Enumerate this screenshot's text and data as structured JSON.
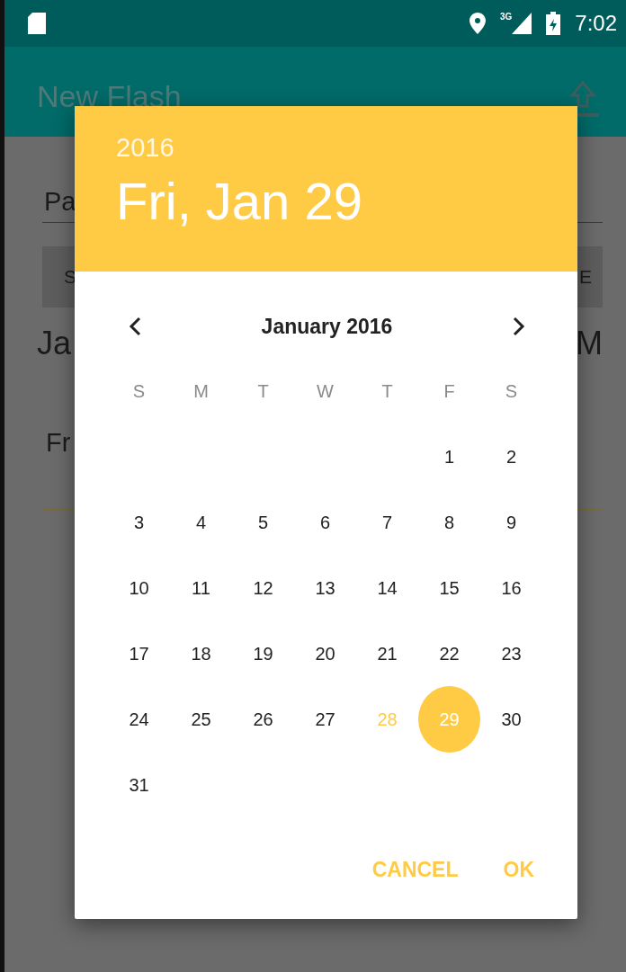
{
  "status_bar": {
    "network": "3G",
    "time": "7:02"
  },
  "app_bar": {
    "title": "New Flash"
  },
  "backdrop": {
    "field_text": "Pa",
    "button_left": "S",
    "button_right": "E",
    "line_left": "Ja",
    "line_right": "M",
    "label": "Fr"
  },
  "dialog": {
    "year": "2016",
    "date": "Fri, Jan 29",
    "month": "January 2016",
    "weekdays": [
      "S",
      "M",
      "T",
      "W",
      "T",
      "F",
      "S"
    ],
    "weeks": [
      [
        {
          "label": "1",
          "selected": false,
          "today": false
        },
        {
          "label": "2",
          "selected": false,
          "today": false
        }
      ],
      [
        {
          "label": "3",
          "selected": false,
          "today": false
        },
        {
          "label": "4",
          "selected": false,
          "today": false
        },
        {
          "label": "5",
          "selected": false,
          "today": false
        },
        {
          "label": "6",
          "selected": false,
          "today": false
        },
        {
          "label": "7",
          "selected": false,
          "today": false
        },
        {
          "label": "8",
          "selected": false,
          "today": false
        },
        {
          "label": "9",
          "selected": false,
          "today": false
        }
      ],
      [
        {
          "label": "10",
          "selected": false,
          "today": false
        },
        {
          "label": "11",
          "selected": false,
          "today": false
        },
        {
          "label": "12",
          "selected": false,
          "today": false
        },
        {
          "label": "13",
          "selected": false,
          "today": false
        },
        {
          "label": "14",
          "selected": false,
          "today": false
        },
        {
          "label": "15",
          "selected": false,
          "today": false
        },
        {
          "label": "16",
          "selected": false,
          "today": false
        }
      ],
      [
        {
          "label": "17",
          "selected": false,
          "today": false
        },
        {
          "label": "18",
          "selected": false,
          "today": false
        },
        {
          "label": "19",
          "selected": false,
          "today": false
        },
        {
          "label": "20",
          "selected": false,
          "today": false
        },
        {
          "label": "21",
          "selected": false,
          "today": false
        },
        {
          "label": "22",
          "selected": false,
          "today": false
        },
        {
          "label": "23",
          "selected": false,
          "today": false
        }
      ],
      [
        {
          "label": "24",
          "selected": false,
          "today": false
        },
        {
          "label": "25",
          "selected": false,
          "today": false
        },
        {
          "label": "26",
          "selected": false,
          "today": false
        },
        {
          "label": "27",
          "selected": false,
          "today": false
        },
        {
          "label": "28",
          "selected": false,
          "today": true
        },
        {
          "label": "29",
          "selected": true,
          "today": false
        },
        {
          "label": "30",
          "selected": false,
          "today": false
        }
      ],
      [
        {
          "label": "31",
          "selected": false,
          "today": false
        }
      ]
    ],
    "buttons": [
      "CANCEL",
      "OK"
    ]
  }
}
